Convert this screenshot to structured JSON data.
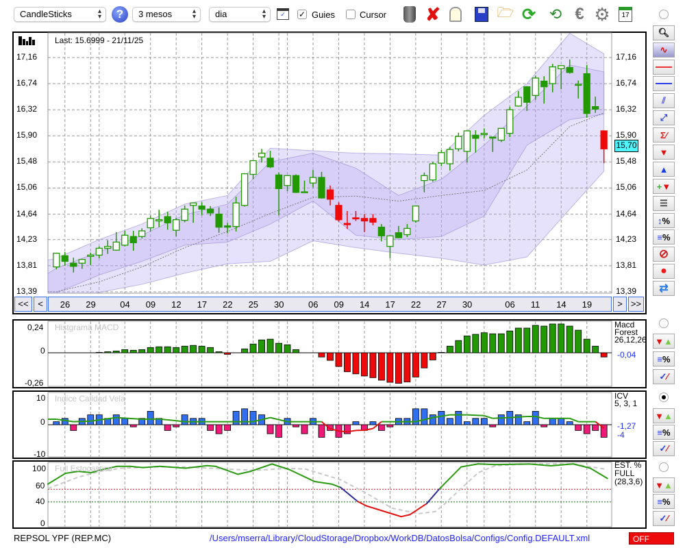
{
  "toolbar": {
    "chart_type": "CandleSticks",
    "period": "3 mesos",
    "interval": "dia",
    "guides_label": "Guies",
    "guides_checked": true,
    "cursor_label": "Cursor",
    "cursor_checked": false,
    "check_mark": "✓",
    "icons": [
      "trash-icon",
      "delete-icon",
      "lamp-icon",
      "save-icon",
      "open-folder-icon",
      "refresh-icon",
      "update-data-icon",
      "euro-icon",
      "settings-icon",
      "calendar-icon"
    ],
    "calendar_day": "17"
  },
  "main": {
    "last_label": "Last: 15.6999 - 21/11/25",
    "price_ticks": [
      "17,16",
      "16,74",
      "16,32",
      "15,90",
      "15,48",
      "15,06",
      "14,64",
      "14,23",
      "13,81",
      "13,39"
    ],
    "price_tick_values": [
      17.16,
      16.74,
      16.32,
      15.9,
      15.48,
      15.06,
      14.64,
      14.23,
      13.81,
      13.39
    ],
    "current_price": "15,70",
    "current_price_value": 15.7,
    "date_labels": [
      {
        "t": "26",
        "i": 1
      },
      {
        "t": "29",
        "i": 4
      },
      {
        "t": "04",
        "i": 8
      },
      {
        "t": "09",
        "i": 11
      },
      {
        "t": "12",
        "i": 14
      },
      {
        "t": "17",
        "i": 17
      },
      {
        "t": "22",
        "i": 20
      },
      {
        "t": "25",
        "i": 23
      },
      {
        "t": "30",
        "i": 26
      },
      {
        "t": "06",
        "i": 30
      },
      {
        "t": "09",
        "i": 33
      },
      {
        "t": "14",
        "i": 36
      },
      {
        "t": "17",
        "i": 39
      },
      {
        "t": "22",
        "i": 42
      },
      {
        "t": "27",
        "i": 45
      },
      {
        "t": "30",
        "i": 48
      },
      {
        "t": "06",
        "i": 53
      },
      {
        "t": "11",
        "i": 56
      },
      {
        "t": "14",
        "i": 59
      },
      {
        "t": "19",
        "i": 62
      }
    ],
    "month_grid": [
      5,
      27,
      50
    ],
    "nav": {
      "first": "<<",
      "prev": "<",
      "next": ">",
      "last": ">>"
    }
  },
  "chart_data": [
    {
      "type": "candlestick",
      "title": "REPSOL YPF (REP.MC)",
      "ylim": [
        13.39,
        17.16
      ],
      "candles": [
        [
          13.79,
          14.02,
          13.75,
          14.01,
          "g"
        ],
        [
          13.97,
          14.03,
          13.81,
          13.88,
          "g"
        ],
        [
          13.85,
          13.94,
          13.7,
          13.8,
          "g"
        ],
        [
          13.85,
          13.92,
          13.76,
          13.91,
          "g"
        ],
        [
          13.96,
          14.02,
          13.82,
          13.98,
          "g"
        ],
        [
          13.98,
          14.12,
          13.93,
          14.09,
          "g"
        ],
        [
          14.09,
          14.22,
          14.0,
          14.12,
          "g"
        ],
        [
          14.06,
          14.35,
          14.05,
          14.19,
          "g"
        ],
        [
          14.14,
          14.37,
          14.12,
          14.3,
          "g"
        ],
        [
          14.28,
          14.37,
          14.05,
          14.18,
          "g"
        ],
        [
          14.28,
          14.41,
          14.25,
          14.37,
          "g"
        ],
        [
          14.42,
          14.62,
          14.36,
          14.57,
          "g"
        ],
        [
          14.53,
          14.71,
          14.43,
          14.55,
          "g"
        ],
        [
          14.6,
          14.68,
          14.39,
          14.5,
          "g"
        ],
        [
          14.38,
          14.58,
          14.28,
          14.55,
          "g"
        ],
        [
          14.54,
          14.78,
          14.51,
          14.72,
          "g"
        ],
        [
          14.78,
          14.82,
          14.5,
          14.82,
          "g"
        ],
        [
          14.77,
          14.83,
          14.62,
          14.72,
          "g"
        ],
        [
          14.72,
          14.77,
          14.61,
          14.66,
          "g"
        ],
        [
          14.64,
          14.75,
          14.34,
          14.43,
          "g"
        ],
        [
          14.45,
          14.5,
          14.33,
          14.43,
          "g"
        ],
        [
          14.44,
          14.92,
          14.36,
          14.82,
          "g"
        ],
        [
          14.78,
          15.3,
          14.76,
          15.29,
          "g"
        ],
        [
          15.28,
          15.51,
          15.2,
          15.5,
          "g"
        ],
        [
          15.56,
          15.69,
          15.47,
          15.62,
          "g"
        ],
        [
          15.54,
          15.66,
          15.38,
          15.4,
          "g"
        ],
        [
          15.27,
          15.31,
          14.62,
          15.05,
          "g"
        ],
        [
          15.1,
          15.27,
          15.01,
          15.26,
          "g"
        ],
        [
          15.26,
          15.28,
          14.98,
          14.99,
          "g"
        ],
        [
          14.99,
          15.18,
          14.98,
          15.0,
          "g"
        ],
        [
          15.14,
          15.35,
          15.07,
          15.23,
          "g"
        ],
        [
          15.23,
          15.32,
          14.89,
          14.9,
          "g"
        ],
        [
          15.03,
          15.1,
          14.78,
          14.88,
          "r"
        ],
        [
          14.78,
          14.83,
          14.52,
          14.55,
          "r"
        ],
        [
          14.49,
          14.69,
          14.4,
          14.47,
          "r"
        ],
        [
          14.58,
          14.69,
          14.53,
          14.57,
          "r"
        ],
        [
          14.57,
          14.64,
          14.35,
          14.53,
          "r"
        ],
        [
          14.57,
          14.64,
          14.46,
          14.51,
          "r"
        ],
        [
          14.43,
          14.48,
          14.2,
          14.29,
          "g"
        ],
        [
          14.12,
          14.29,
          13.93,
          14.29,
          "g"
        ],
        [
          14.34,
          14.45,
          14.25,
          14.26,
          "g"
        ],
        [
          14.31,
          14.48,
          14.27,
          14.41,
          "g"
        ],
        [
          14.53,
          14.78,
          14.5,
          14.77,
          "g"
        ],
        [
          15.18,
          15.31,
          14.99,
          15.26,
          "g"
        ],
        [
          15.19,
          15.48,
          15.16,
          15.45,
          "g"
        ],
        [
          15.46,
          15.67,
          15.41,
          15.63,
          "g"
        ],
        [
          15.45,
          15.72,
          15.34,
          15.68,
          "g"
        ],
        [
          15.69,
          15.95,
          15.65,
          15.89,
          "g"
        ],
        [
          15.65,
          15.98,
          15.47,
          15.98,
          "g"
        ],
        [
          15.91,
          15.99,
          15.63,
          15.86,
          "g"
        ],
        [
          15.92,
          16.02,
          15.86,
          15.94,
          "g"
        ],
        [
          15.88,
          15.88,
          15.64,
          15.88,
          "g"
        ],
        [
          15.83,
          16.02,
          15.8,
          16.02,
          "g"
        ],
        [
          15.94,
          16.37,
          15.88,
          16.32,
          "g"
        ],
        [
          16.38,
          16.62,
          16.37,
          16.52,
          "g"
        ],
        [
          16.69,
          16.7,
          16.3,
          16.44,
          "g"
        ],
        [
          16.55,
          16.87,
          16.48,
          16.83,
          "g"
        ],
        [
          16.78,
          16.86,
          16.42,
          16.69,
          "g"
        ],
        [
          16.74,
          17.06,
          16.6,
          17.01,
          "g"
        ],
        [
          16.98,
          17.03,
          16.65,
          17.03,
          "g"
        ],
        [
          17.0,
          17.13,
          16.9,
          16.92,
          "g"
        ],
        [
          16.72,
          16.79,
          16.5,
          16.73,
          "g"
        ],
        [
          16.9,
          17.04,
          16.19,
          16.26,
          "g"
        ],
        [
          16.37,
          16.53,
          16.27,
          16.33,
          "g"
        ],
        [
          15.98,
          15.98,
          15.46,
          15.69,
          "r"
        ]
      ],
      "bands_fields": [
        "index",
        "outer_upper",
        "inner_upper",
        "ma",
        "inner_lower",
        "outer_lower"
      ],
      "bands": [
        [
          -1,
          13.9,
          13.68,
          13.39,
          13.3,
          13.1
        ],
        [
          0,
          13.93,
          13.77,
          13.39,
          13.37,
          13.2
        ],
        [
          5,
          14.23,
          14.03,
          13.55,
          13.66,
          13.38
        ],
        [
          10,
          14.48,
          14.3,
          13.79,
          13.88,
          13.51
        ],
        [
          15,
          14.8,
          14.63,
          14.1,
          14.14,
          13.69
        ],
        [
          20,
          14.94,
          14.8,
          14.36,
          14.19,
          13.84
        ],
        [
          25,
          15.7,
          15.48,
          14.65,
          14.48,
          13.88
        ],
        [
          30,
          15.66,
          15.62,
          14.91,
          14.85,
          14.21
        ],
        [
          35,
          15.62,
          15.38,
          14.93,
          14.3,
          14.1
        ],
        [
          40,
          15.61,
          14.94,
          14.85,
          14.23,
          14.01
        ],
        [
          45,
          15.59,
          15.2,
          14.94,
          14.28,
          13.93
        ],
        [
          50,
          16.23,
          15.75,
          15.02,
          14.61,
          13.82
        ],
        [
          55,
          16.74,
          16.38,
          15.35,
          15.75,
          13.95
        ],
        [
          60,
          17.55,
          17.04,
          16.05,
          16.16,
          14.72
        ],
        [
          64,
          17.22,
          16.93,
          16.27,
          16.25,
          15.33
        ]
      ]
    },
    {
      "type": "bar",
      "title": "Histgrama MACD",
      "ylim": [
        -0.26,
        0.24
      ],
      "values": [
        0,
        0,
        0,
        0,
        0,
        0.004,
        0.01,
        0.017,
        0.03,
        0.024,
        0.03,
        0.05,
        0.057,
        0.057,
        0.05,
        0.063,
        0.07,
        0.063,
        0.05,
        0.01,
        -0.015,
        0,
        0.037,
        0.083,
        0.122,
        0.129,
        0.09,
        0.076,
        0.03,
        0,
        0,
        -0.04,
        -0.072,
        -0.13,
        -0.18,
        -0.2,
        -0.22,
        -0.236,
        -0.26,
        -0.28,
        -0.29,
        -0.277,
        -0.23,
        -0.144,
        -0.068,
        0.004,
        0.063,
        0.116,
        0.16,
        0.175,
        0.19,
        0.18,
        0.18,
        0.207,
        0.234,
        0.234,
        0.26,
        0.253,
        0.273,
        0.273,
        0.253,
        0.214,
        0.129,
        0.063,
        -0.04
      ]
    },
    {
      "type": "bar",
      "title": "Indice Calidad Vela",
      "ylim": [
        -10,
        10
      ],
      "values": [
        1.1,
        2.3,
        -2.1,
        2.3,
        3.6,
        3.6,
        2.3,
        3.6,
        2.3,
        -0.8,
        2.3,
        4.9,
        2.3,
        -2.1,
        -0.8,
        3.6,
        2.3,
        2.3,
        -2.1,
        -3.3,
        -2.1,
        4.9,
        5.8,
        4.9,
        3.6,
        -3.3,
        -4.6,
        2.3,
        -0.8,
        -3.3,
        2.3,
        -4.6,
        -2.1,
        -4.6,
        -3.3,
        1.1,
        -2.1,
        1.1,
        -2.1,
        -0.8,
        2.3,
        2.3,
        5.8,
        5.8,
        3.6,
        4.9,
        2.3,
        4.9,
        1.1,
        2.3,
        2.3,
        -0.8,
        3.6,
        4.9,
        3.6,
        1.1,
        4.9,
        -0.8,
        2.3,
        2.3,
        1.1,
        -2.1,
        -3.3,
        -2.1,
        -4.6
      ],
      "signal": [
        [
          -1,
          2.0
        ],
        [
          0,
          2.0
        ],
        [
          2,
          1.1
        ],
        [
          4,
          1.3
        ],
        [
          7,
          2.6
        ],
        [
          10,
          2.0
        ],
        [
          12,
          2.1
        ],
        [
          15,
          1.1
        ],
        [
          20,
          1.1
        ],
        [
          23,
          1.1
        ],
        [
          25,
          2.6
        ],
        [
          27,
          1.1
        ],
        [
          31,
          1.1
        ],
        [
          32,
          -1.5
        ],
        [
          33,
          -2.3
        ],
        [
          34,
          -2.6
        ],
        [
          35,
          -2.1
        ],
        [
          36,
          -2.0
        ],
        [
          37,
          -1.4
        ],
        [
          38,
          1.1
        ],
        [
          42,
          1.1
        ],
        [
          44,
          2.6
        ],
        [
          46,
          3.6
        ],
        [
          48,
          3.6
        ],
        [
          50,
          3.3
        ],
        [
          51,
          2.3
        ],
        [
          53,
          2.6
        ],
        [
          55,
          3.0
        ],
        [
          56,
          3.0
        ],
        [
          57,
          2.3
        ],
        [
          60,
          2.3
        ],
        [
          61,
          1.1
        ],
        [
          63,
          1.1
        ],
        [
          64,
          -1.27
        ]
      ]
    },
    {
      "type": "line",
      "title": "Full Estocastico",
      "ylim": [
        0,
        100
      ],
      "levels": [
        60,
        40
      ],
      "k": [
        [
          -1,
          68
        ],
        [
          1.06,
          85
        ],
        [
          2.56,
          88
        ],
        [
          4.07,
          86
        ],
        [
          5.08,
          90
        ],
        [
          7.1,
          96
        ],
        [
          8.6,
          96
        ],
        [
          10.1,
          94
        ],
        [
          12.1,
          96
        ],
        [
          15.1,
          93
        ],
        [
          17.6,
          97
        ],
        [
          18.6,
          96
        ],
        [
          21.2,
          83.5
        ],
        [
          22.7,
          88
        ],
        [
          25.2,
          99.6
        ],
        [
          27.2,
          91
        ],
        [
          30.2,
          72
        ],
        [
          32.2,
          68
        ],
        [
          33.2,
          63
        ],
        [
          35.2,
          41
        ],
        [
          36.2,
          34
        ],
        [
          39.2,
          21.5
        ],
        [
          40.3,
          17
        ],
        [
          41.3,
          20
        ],
        [
          43.3,
          37.6
        ],
        [
          44.8,
          61
        ],
        [
          47.3,
          95
        ],
        [
          49.3,
          99.7
        ],
        [
          51.3,
          98.6
        ],
        [
          55.3,
          99.6
        ],
        [
          57.8,
          96.8
        ],
        [
          60.4,
          99.7
        ],
        [
          62.4,
          93
        ],
        [
          64.4,
          77
        ]
      ],
      "d": [
        [
          -1,
          61
        ],
        [
          2.56,
          79
        ],
        [
          5.08,
          88
        ],
        [
          7.6,
          93
        ],
        [
          11.6,
          95
        ],
        [
          15.1,
          95
        ],
        [
          20.2,
          91.4
        ],
        [
          23.2,
          89.6
        ],
        [
          27.2,
          93
        ],
        [
          29.2,
          91.4
        ],
        [
          33.2,
          75
        ],
        [
          36.2,
          54
        ],
        [
          39.2,
          30.5
        ],
        [
          42.3,
          21.5
        ],
        [
          44.3,
          25
        ],
        [
          45.3,
          36
        ],
        [
          47.3,
          61
        ],
        [
          49.3,
          86
        ],
        [
          51.3,
          97
        ],
        [
          55.3,
          99.7
        ],
        [
          60.4,
          99.7
        ],
        [
          64.4,
          91
        ]
      ]
    }
  ],
  "macd": {
    "title": "Histgrama MACD",
    "ticks": [
      "0,24",
      "0",
      "-0,26"
    ],
    "name": "Macd",
    "sub": "Forest",
    "params": "26,12,26",
    "value": "-0,04"
  },
  "icv": {
    "title": "Indice Calidad Vela",
    "ticks": [
      "10",
      "0",
      "-10"
    ],
    "name": "ICV",
    "params": "5, 3, 1",
    "value": "-1,27",
    "value2": "-4"
  },
  "stoch": {
    "title": "Full Estocastico",
    "ticks": [
      "100",
      "60",
      "40",
      "0"
    ],
    "name": "EST. %",
    "sub": "FULL",
    "params": "(28,3,6)"
  },
  "footer": {
    "ticker": "REPSOL YPF (REP.MC)",
    "path": "/Users/mserra/Library/CloudStorage/Dropbox/WorkDB/DatosBolsa/Configs/Config.DEFAULT.xml",
    "status": "OFF"
  },
  "colors": {
    "green": "#229900",
    "red": "#ee0a0a",
    "blue_bar": "#2f6ff0",
    "pink_bar": "#ee1a78",
    "band": "#b4a8f0",
    "cyan": "#4ff6ff"
  }
}
